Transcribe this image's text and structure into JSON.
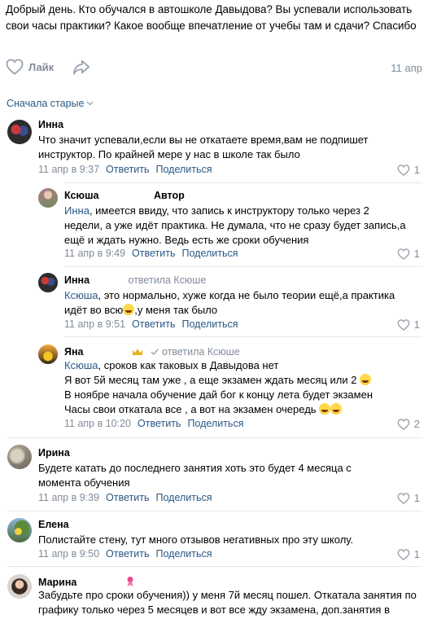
{
  "post": {
    "text": "Добрый день. Кто обучался в автошколе Давыдова? Вы успевали использовать свои часы практики? Какое вообще впечатление от учебы там и сдачи? Спасибо",
    "like_label": "Лайк",
    "date": "11 апр"
  },
  "comments_header": {
    "sort_label": "Сначала старые"
  },
  "comments": [
    {
      "author": "Инна",
      "text": "Что значит успевали,если вы не откатаете время,вам не подпишет инструктор. По крайней мере у нас в школе так было",
      "date": "11 апр в 9:37",
      "reply_label": "Ответить",
      "share_label": "Поделиться",
      "likes": "1"
    },
    {
      "author": "Ксюша",
      "badge": "Автор",
      "mention": "Инна",
      "text": ", имеется ввиду, что запись к инструктору только через 2 недели, а уже идёт практика. Не думала, что не сразу будет запись,а ещё и ждать нужно. Ведь есть же сроки обучения",
      "date": "11 апр в 9:49",
      "reply_label": "Ответить",
      "share_label": "Поделиться",
      "likes": "1"
    },
    {
      "author": "Инна",
      "replied_to": "ответила Ксюше",
      "mention": "Ксюша",
      "text": ", это нормально, хуже когда не было теории ещё,а практика идёт во всю",
      "text_after": ",у меня так было",
      "date": "11 апр в 9:51",
      "reply_label": "Ответить",
      "share_label": "Поделиться",
      "likes": "1"
    },
    {
      "author": "Яна",
      "replied_to": "ответила Ксюше",
      "mention": "Ксюша",
      "line1": ", сроков как таковых в Давыдова нет",
      "line2": "Я вот 5й месяц там уже , а еще экзамен ждать месяц или 2",
      "line3": "В ноябре начала обучение дай бог к концу лета будет экзамен",
      "line4": "Часы свои откатала все , а вот на экзамен очередь",
      "date": "11 апр в 10:20",
      "reply_label": "Ответить",
      "share_label": "Поделиться",
      "likes": "2"
    },
    {
      "author": "Ирина",
      "text": "Будете катать до последнего занятия хоть это будет 4 месяца с момента обучения",
      "date": "11 апр в 9:39",
      "reply_label": "Ответить",
      "share_label": "Поделиться",
      "likes": "1"
    },
    {
      "author": "Елена",
      "text": "Полистайте стену, тут много отзывов негативных про эту школу.",
      "date": "11 апр в 9:50",
      "reply_label": "Ответить",
      "share_label": "Поделиться",
      "likes": "1"
    },
    {
      "author": "Марина",
      "text": "Забудьте про сроки обучения)) у меня 7й месяц пошел. Откатала занятия по графику только через 5 месяцев и вот все жду экзамена, доп.занятия в"
    }
  ],
  "colors": {
    "link": "#2a5885",
    "muted": "#818c99",
    "divider": "#e7e8ec"
  }
}
